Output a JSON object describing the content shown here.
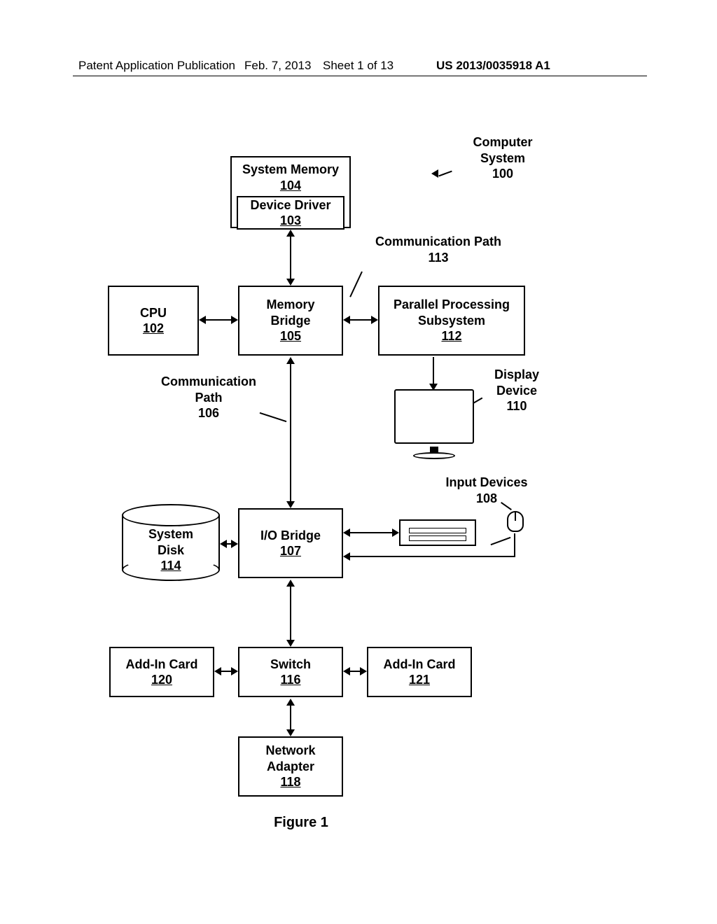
{
  "header": {
    "left": "Patent Application Publication",
    "date": "Feb. 7, 2013",
    "sheet": "Sheet 1 of 13",
    "pubno": "US 2013/0035918 A1"
  },
  "labels": {
    "computer_system": "Computer\nSystem",
    "computer_system_num": "100",
    "comm_path_113": "Communication Path",
    "comm_path_113_num": "113",
    "comm_path_106": "Communication\nPath",
    "comm_path_106_num": "106",
    "display_device": "Display\nDevice",
    "display_device_num": "110",
    "input_devices": "Input Devices",
    "input_devices_num": "108"
  },
  "boxes": {
    "system_memory": {
      "title": "System Memory",
      "num": "104"
    },
    "device_driver": {
      "title": "Device Driver",
      "num": "103"
    },
    "cpu": {
      "title": "CPU",
      "num": "102"
    },
    "memory_bridge": {
      "title": "Memory\nBridge",
      "num": "105"
    },
    "pps": {
      "title": "Parallel Processing\nSubsystem",
      "num": "112"
    },
    "io_bridge": {
      "title": "I/O Bridge",
      "num": "107"
    },
    "system_disk": {
      "title": "System\nDisk",
      "num": "114"
    },
    "addin_120": {
      "title": "Add-In Card",
      "num": "120"
    },
    "switch": {
      "title": "Switch",
      "num": "116"
    },
    "addin_121": {
      "title": "Add-In Card",
      "num": "121"
    },
    "net_adapter": {
      "title": "Network\nAdapter",
      "num": "118"
    }
  },
  "figure_caption": "Figure 1"
}
